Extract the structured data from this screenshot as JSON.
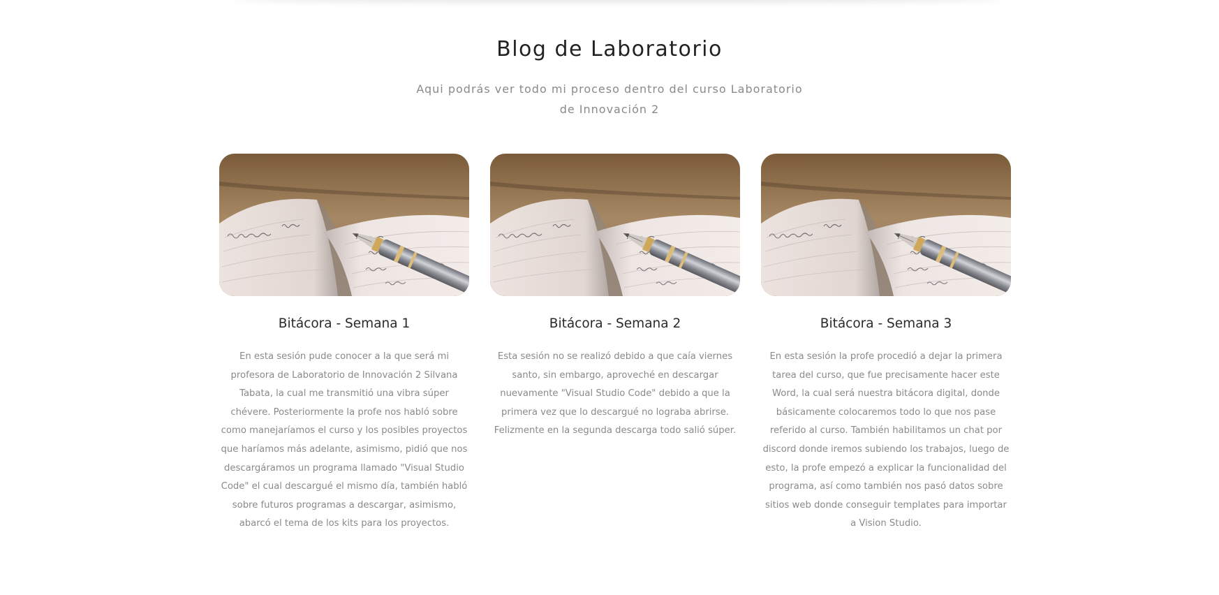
{
  "header": {
    "title": "Blog de Laboratorio",
    "subtitle": "Aqui podrás ver todo mi proceso dentro del curso Laboratorio de Innovación 2"
  },
  "cards": [
    {
      "image": "notebook-with-fountain-pen",
      "title": "Bitácora - Semana 1",
      "text": "En esta sesión pude conocer a la que será mi profesora de Laboratorio de Innovación 2 Silvana Tabata, la cual me transmitió una vibra súper chévere. Posteriormente la profe nos habló sobre como manejaríamos el curso y los posibles proyectos que haríamos más adelante, asimismo, pidió que nos descargáramos un programa llamado \"Visual Studio Code\" el cual descargué el mismo día, también habló sobre futuros programas a descargar, asimismo, abarcó el tema de los kits para los proyectos."
    },
    {
      "image": "notebook-with-fountain-pen",
      "title": "Bitácora - Semana 2",
      "text": "Esta sesión no se realizó debido a que caía viernes santo, sin embargo, aproveché en descargar nuevamente \"Visual Studio Code\" debido a que la primera vez que lo descargué no lograba abrirse. Felizmente en la segunda descarga todo salió súper."
    },
    {
      "image": "notebook-with-fountain-pen",
      "title": "Bitácora - Semana 3",
      "text": "En esta sesión la profe procedió a dejar la primera tarea del curso, que fue precisamente hacer este Word, la cual será nuestra bitácora digital, donde básicamente colocaremos todo lo que nos pase referido al curso. También habilitamos un chat por discord donde iremos subiendo los trabajos, luego de esto, la profe empezó a explicar la funcionalidad del programa, así como también nos pasó datos sobre sitios web donde conseguir templates para importar a Vision Studio."
    }
  ],
  "colors": {
    "title": "#222222",
    "body_text": "#8a8a8a",
    "wood": "#8a6a44",
    "paper": "#e8ddd8"
  }
}
